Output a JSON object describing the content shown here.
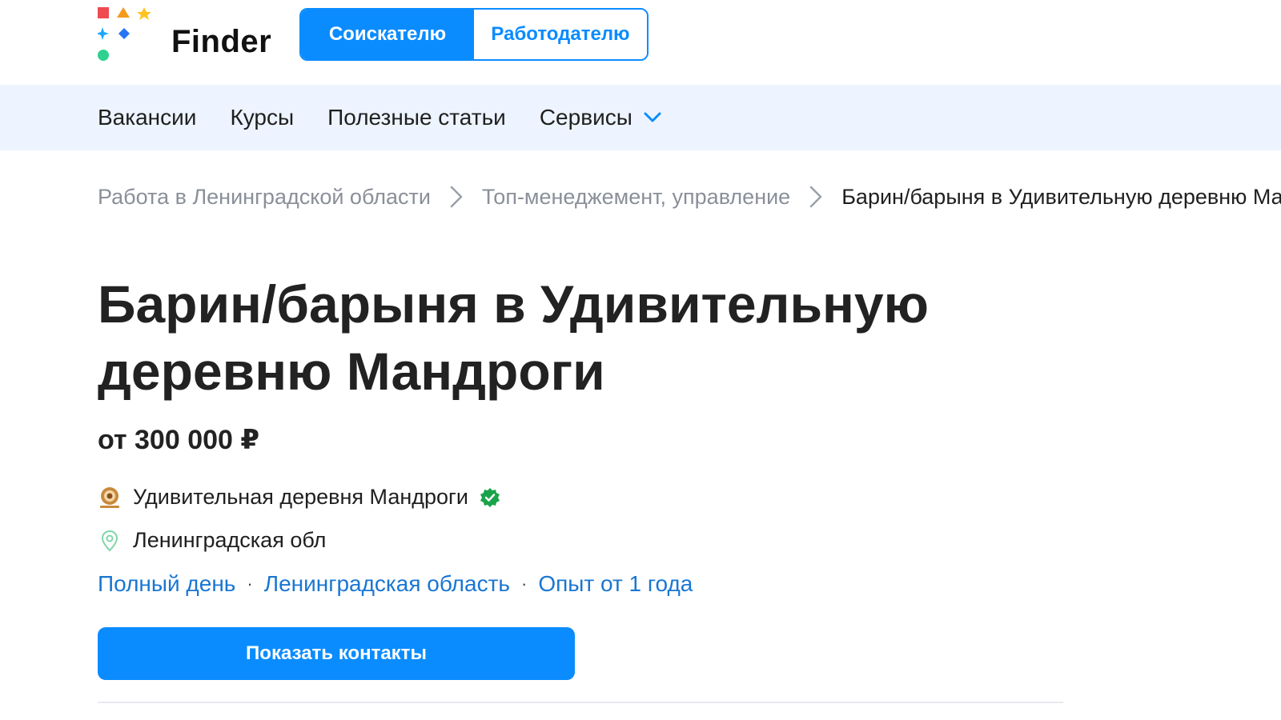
{
  "header": {
    "logo_text": "Finder",
    "segment": {
      "active_label": "Соискателю",
      "inactive_label": "Работодателю"
    }
  },
  "nav": {
    "items": [
      {
        "label": "Вакансии"
      },
      {
        "label": "Курсы"
      },
      {
        "label": "Полезные статьи"
      },
      {
        "label": "Сервисы",
        "icon": "chevron-down-icon"
      }
    ]
  },
  "breadcrumb": {
    "items": [
      "Работа в Ленинградской области",
      "Топ-менеджемент, управление",
      "Барин/барыня в Удивительную деревню Мандроги"
    ]
  },
  "vacancy": {
    "title": "Барин/барыня в Удивительную деревню Мандроги",
    "salary": "от 300 000 ₽",
    "company": "Удивительная деревня Мандроги",
    "location": "Ленинградская обл",
    "tags": [
      "Полный день",
      "Ленинградская область",
      "Опыт от 1 года"
    ],
    "cta_label": "Показать контакты"
  },
  "colors": {
    "accent": "#0a8cff",
    "nav_bg": "#edf4ff",
    "link": "#1976d2",
    "verified": "#1aa34a"
  }
}
